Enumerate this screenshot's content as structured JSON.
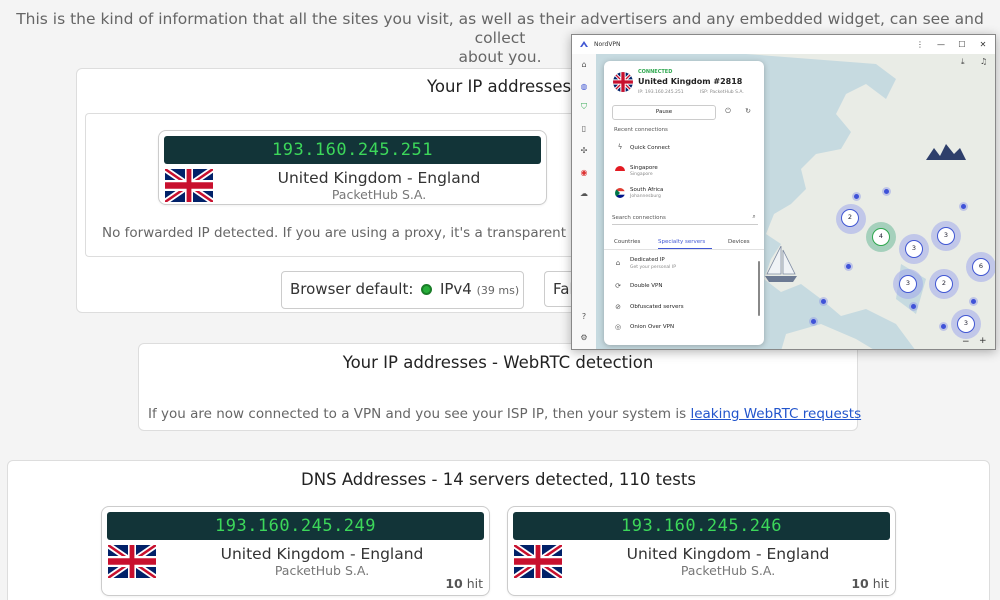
{
  "intro": {
    "line1": "This is the kind of information that all the sites you visit, as well as their advertisers and any embedded widget, can see and collect",
    "line2": "about you."
  },
  "ip_section": {
    "title": "Your IP addresses",
    "ip": "193.160.245.251",
    "location": "United Kingdom - England",
    "isp": "PacketHub S.A.",
    "no_forward_note": "No forwarded IP detected. If you are using a proxy, it's a transparent p",
    "browser_default_label": "Browser default:",
    "protocol": "IPv4",
    "latency": "(39 ms)",
    "fallback_partial": "Fal"
  },
  "webrtc_section": {
    "title": "Your IP addresses - WebRTC detection",
    "note": "If you are now connected to a VPN and you see your ISP IP, then your system is ",
    "link": "leaking WebRTC requests"
  },
  "dns_section": {
    "title": "DNS Addresses - 14 servers detected, 110 tests",
    "servers": [
      {
        "ip": "193.160.245.249",
        "location": "United Kingdom - England",
        "isp": "PacketHub S.A.",
        "hits": "10",
        "hit_label": "hit"
      },
      {
        "ip": "193.160.245.246",
        "location": "United Kingdom - England",
        "isp": "PacketHub S.A.",
        "hits": "10",
        "hit_label": "hit"
      }
    ]
  },
  "vpn_app": {
    "window_title": "NordVPN",
    "status": "CONNECTED",
    "server": "United Kingdom #2818",
    "ip_line": "IP: 193.160.245.251",
    "isp_line": "ISP: PacketHub S.A.",
    "pause_label": "Pause",
    "recent_label": "Recent connections",
    "quick_connect": "Quick Connect",
    "recent": [
      {
        "name": "Singapore",
        "city": "Singapore"
      },
      {
        "name": "South Africa",
        "city": "Johannesburg"
      }
    ],
    "search_placeholder": "Search connections",
    "tabs": [
      "Countries",
      "Specialty servers",
      "Devices"
    ],
    "active_tab": "Specialty servers",
    "specialty": [
      {
        "name": "Dedicated IP",
        "sub": "Get your personal IP"
      },
      {
        "name": "Double VPN",
        "sub": ""
      },
      {
        "name": "Obfuscated servers",
        "sub": ""
      },
      {
        "name": "Onion Over VPN",
        "sub": ""
      }
    ],
    "map_clusters": [
      "2",
      "4",
      "3",
      "3",
      "3",
      "2",
      "6",
      "3"
    ],
    "zoom_out": "−",
    "zoom_in": "+",
    "accent_color": "#4157d3",
    "connected_color": "#2fa84f"
  },
  "colors": {
    "ip_bg": "#123438",
    "ip_text": "#3cd75a",
    "link": "#2255cc"
  }
}
